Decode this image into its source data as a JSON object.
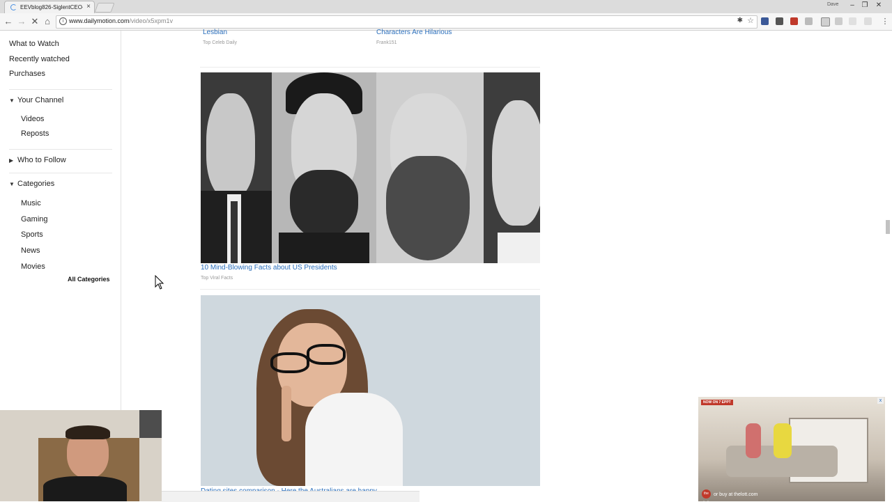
{
  "browser": {
    "tab_title": "EEVblog826-SiglentCEO-",
    "close_symbol": "×",
    "profile_label": "Dave",
    "url_host": "www.dailymotion.com",
    "url_path": "/video/x5xpm1v"
  },
  "sidebar": {
    "top_links": [
      "What to Watch",
      "Recently watched",
      "Purchases"
    ],
    "your_channel": {
      "label": "Your Channel",
      "items": [
        "Videos",
        "Reposts"
      ]
    },
    "who_to_follow": {
      "label": "Who to Follow"
    },
    "categories": {
      "label": "Categories",
      "items": [
        "Music",
        "Gaming",
        "Sports",
        "News",
        "Movies"
      ],
      "all_label": "All Categories"
    }
  },
  "feed": {
    "top_left": {
      "title": "Lesbian",
      "source": "Top Celeb Daily"
    },
    "top_right": {
      "title": "Characters Are Hilarious",
      "source": "Frank151"
    },
    "cards": [
      {
        "title": "10 Mind-Blowing Facts about US Presidents",
        "source": "Top Viral Facts"
      },
      {
        "title": "Dating sites comparison - Here the Australians are happy"
      }
    ]
  },
  "ad": {
    "badge": "NOW ON 7 EPPT",
    "logo": "the Lott",
    "cta": "or buy at thelott.com",
    "close_symbol": "x"
  },
  "colors": {
    "link": "#2a6ebb",
    "source": "#999999",
    "accent_red": "#c0392b"
  }
}
